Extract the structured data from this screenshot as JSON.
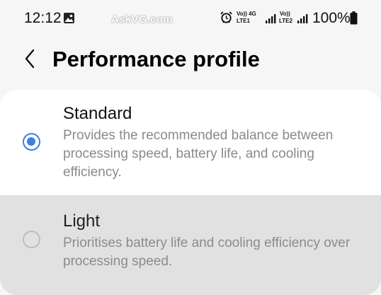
{
  "status_bar": {
    "time": "12:12",
    "watermark": "AskVG.com",
    "sim1_top": "Vo)) 4G",
    "sim1_bottom": "LTE1",
    "sim2_top": "Vo))",
    "sim2_bottom": "LTE2",
    "battery": "100%",
    "icons": [
      "gallery-icon",
      "alarm-icon",
      "signal-icon",
      "battery-icon"
    ]
  },
  "header": {
    "back_icon": "chevron-left-icon",
    "title": "Performance profile"
  },
  "options": [
    {
      "title": "Standard",
      "description": "Provides the recommended balance between processing speed, battery life, and cooling efficiency.",
      "selected": true
    },
    {
      "title": "Light",
      "description": "Prioritises battery life and cooling efficiency over processing speed.",
      "selected": false
    }
  ],
  "colors": {
    "accent": "#3e7ee6",
    "background": "#f6f6f6",
    "card": "#ffffff",
    "pressed_row": "#e1e1e1"
  }
}
